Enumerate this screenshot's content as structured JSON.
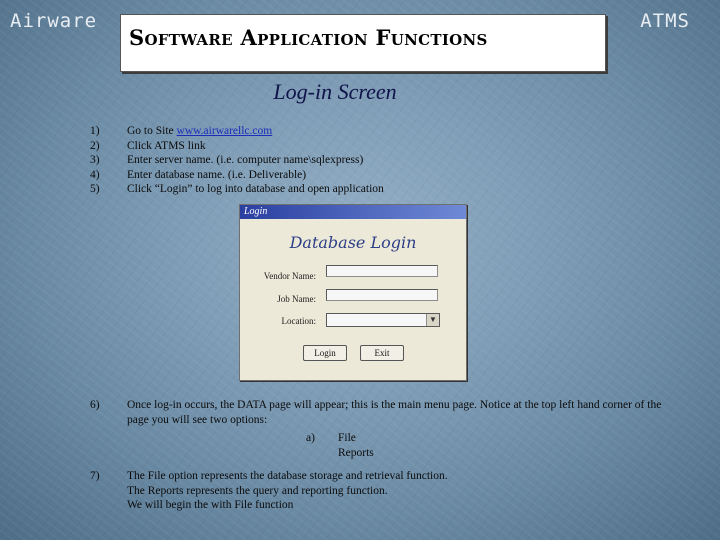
{
  "header": {
    "brand_left": "Airware",
    "brand_right": "ATMS",
    "title": "Software Application Functions"
  },
  "subtitle": "Log-in Screen",
  "steps": [
    {
      "num": "1)",
      "text": "Go to Site",
      "link": "www.airwarellc.com"
    },
    {
      "num": "2)",
      "text": "Click ATMS link"
    },
    {
      "num": "3)",
      "text": "Enter server name. (i.e. computer name\\sqlexpress)"
    },
    {
      "num": "4)",
      "text": "Enter database name. (i.e. Deliverable)"
    },
    {
      "num": "5)",
      "text": "Click “Login” to log into database and open application"
    }
  ],
  "dialog": {
    "title": "Login",
    "heading": "Database Login",
    "labels": {
      "vendor": "Vendor Name:",
      "job": "Job Name:",
      "location": "Location:"
    },
    "login_button": "Login",
    "exit_button": "Exit"
  },
  "step6": {
    "num": "6)",
    "text": "Once log-in occurs, the DATA page will appear; this is the main menu page. Notice at the top left hand corner of the page you will see two options:",
    "option_letter": "a)",
    "options": [
      "File",
      "Reports"
    ]
  },
  "step7": {
    "num": "7)",
    "lines": [
      "The File option represents the database storage and retrieval function.",
      "The Reports represents the query and reporting function.",
      "We will begin the with File function"
    ]
  }
}
